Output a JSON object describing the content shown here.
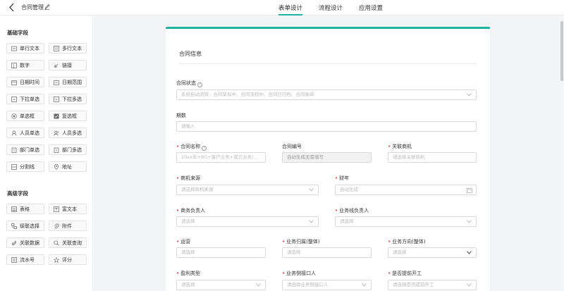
{
  "header": {
    "title": "合同管理",
    "tabs": [
      "表单设计",
      "流程设计",
      "应用设置"
    ]
  },
  "sidebar": {
    "basic_title": "基础字段",
    "basic_fields": [
      "单行文本",
      "多行文本",
      "数字",
      "链接",
      "日期时间",
      "日期范围",
      "下拉单选",
      "下拉多选",
      "单选框",
      "复选框",
      "人员单选",
      "人员多选",
      "部门单选",
      "部门多选",
      "分割线",
      "地址"
    ],
    "advanced_title": "高级字段",
    "advanced_fields": [
      "表格",
      "富文本",
      "级联选择",
      "附件",
      "关联数据",
      "关联查询",
      "流水号",
      "评分"
    ]
  },
  "form": {
    "section_title": "合同信息",
    "status_label": "合同状态",
    "status_placeholder": "系统自动流转：合同草拟中、合同流程中、合同已归档、合同输单",
    "period_label": "期数",
    "period_placeholder": "请输入",
    "name_label": "合同名称",
    "name_placeholder": "20xx年+BG+客户业务+我方业务/...",
    "code_label": "合同编号",
    "code_value": "自动生成无需填写",
    "business_label": "关联商机",
    "business_placeholder": "请选择关联商机",
    "source_label": "商机来源",
    "source_placeholder": "请选择商机来源",
    "fiscal_label": "财年",
    "fiscal_placeholder": "自动生成",
    "biz_owner_label": "商务负责人",
    "biz_owner_placeholder": "请选择",
    "line_owner_label": "业务线负责人",
    "line_owner_placeholder": "请选择",
    "ops_label": "运营",
    "ops_placeholder": "请选择",
    "belong_label": "业务归属(整体)",
    "belong_placeholder": "请选择",
    "direction_label": "业务方向(整体)",
    "direction_placeholder": "请选择",
    "profit_label": "盈利类型",
    "profit_placeholder": "请选择",
    "contact_label": "业务侧接口人",
    "contact_placeholder": "请选择业务侧接口人",
    "early_label": "是否提前开工",
    "early_placeholder": "请选择是否提前开工"
  },
  "colors": {
    "accent": "#1fb3a6",
    "required": "#e33333",
    "canvas_bg": "#f2f3f5"
  }
}
